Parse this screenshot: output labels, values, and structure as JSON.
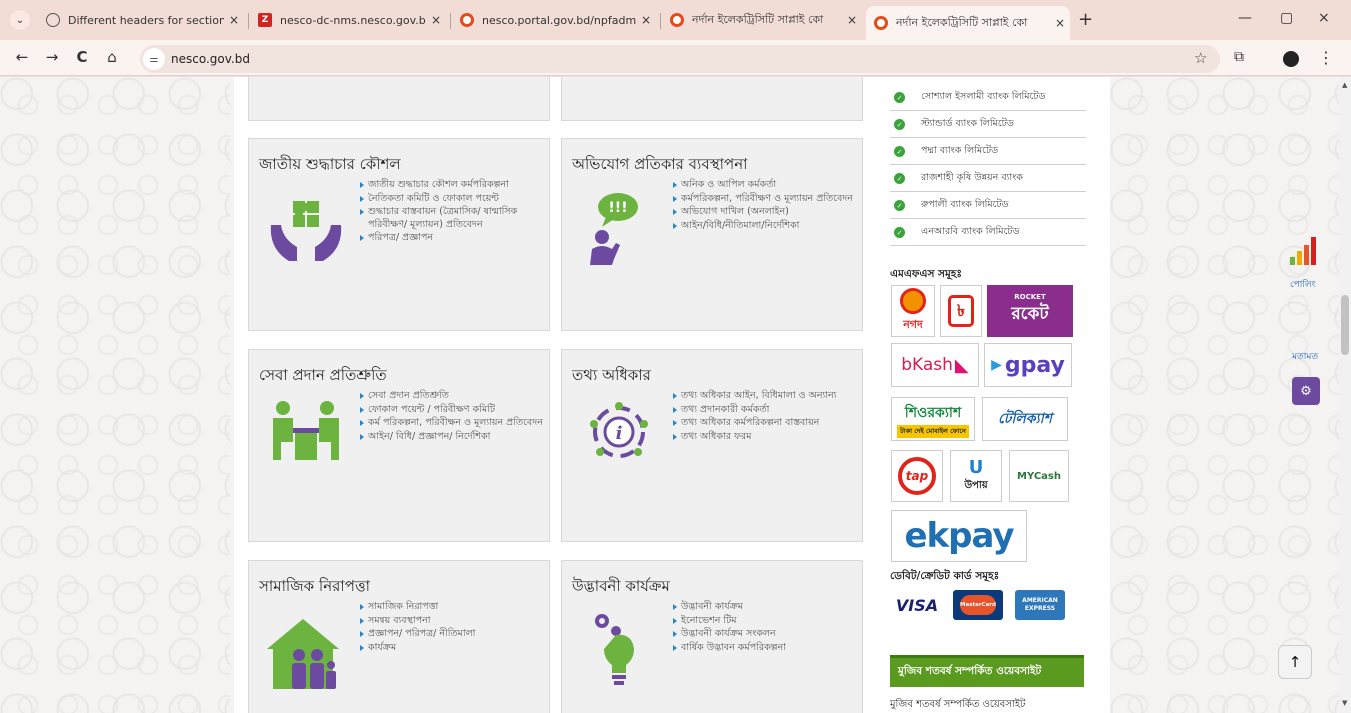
{
  "browser": {
    "tabs": [
      {
        "label": "Different headers for sections",
        "icon": "globe-icon",
        "active": false
      },
      {
        "label": "nesco-dc-nms.nesco.gov.bd:8",
        "icon": "z-favicon-icon",
        "active": false
      },
      {
        "label": "nesco.portal.gov.bd/npfadmin",
        "icon": "nesco-favicon-icon",
        "active": false
      },
      {
        "label": "নর্দান ইলেকট্রিসিটি সাপ্লাই কো",
        "icon": "nesco-favicon-icon",
        "active": false
      },
      {
        "label": "নর্দান ইলেকট্রিসিটি সাপ্লাই কো",
        "icon": "nesco-favicon-icon",
        "active": true
      }
    ],
    "url": "nesco.gov.bd",
    "tab_dropdown": "⌄",
    "new_tab": "+",
    "back": "←",
    "forward": "→",
    "reload": "C",
    "home": "⌂",
    "bookmark": "☆",
    "extensions": "⧉",
    "menu": "⋮",
    "close_tab": "×",
    "minimize": "—",
    "maximize": "▢",
    "close_window": "×"
  },
  "cards": [
    {
      "title": "জাতীয় শুদ্ধাচার কৌশল",
      "icon": "integrity-hands-icon",
      "links": [
        "জাতীয় শুদ্ধাচার কৌশল কর্মপরিকল্পনা",
        "নৈতিকতা কমিটি ও ফোকাল পয়েন্ট",
        "শুদ্ধাচার বাস্তবায়ন (ত্রৈমাসিক/ ষান্মাসিক পরিবীক্ষণ/ মূল্যায়ন) প্রতিবেদন",
        "পরিপত্র/ প্রজ্ঞাপন"
      ]
    },
    {
      "title": "অভিযোগ প্রতিকার ব্যবস্থাপনা",
      "icon": "complaint-speech-icon",
      "links": [
        "অনিক ও আপিল কর্মকর্তা",
        "কর্মপরিকল্পনা, পরিবীক্ষণ ও মূল্যায়ন প্রতিবেদন",
        "অভিযোগ দাখিল (অনলাইন)",
        "আইন/বিধি/নীতিমালা/নির্দেশিকা"
      ]
    },
    {
      "title": "সেবা প্রদান প্রতিশ্রুতি",
      "icon": "service-meeting-icon",
      "links": [
        "সেবা প্রদান প্রতিশ্রুতি",
        "ফোকাল পয়েন্ট / পরিবীক্ষণ কমিটি",
        "কর্ম পরিকল্পনা, পরিবীক্ষন ও মূল্যায়ন প্রতিবেদন",
        "আইন/ বিধি/ প্রজ্ঞাপন/ নির্দেশিকা"
      ]
    },
    {
      "title": "তথ্য অধিকার",
      "icon": "information-icon",
      "links": [
        "তথ্য অধিকার আইন, বিধিমালা ও অন্যান্য",
        "তথ্য প্রদানকারী কর্মকর্তা",
        "তথ্য অধিকার কর্মপরিকল্পনা বাস্তবায়ন",
        "তথ্য অধিকার ফরম"
      ]
    },
    {
      "title": "সামাজিক নিরাপত্তা",
      "icon": "family-house-icon",
      "links": [
        "সামাজিক নিরাপত্তা",
        "সমন্বয় ব্যবস্থাপনা",
        "প্রজ্ঞাপন/ পরিপত্র/ নীতিমালা",
        "কার্যক্রম"
      ]
    },
    {
      "title": "উদ্ভাবনী কার্যক্রম",
      "icon": "innovation-bulb-icon",
      "links": [
        "উদ্ভাবনী কার্যক্রম",
        "ইনোভেশন টিম",
        "উদ্ভাবনী কার্যক্রম সংকলন",
        "বার্ষিক উদ্ভাবন কর্মপরিকল্পনা"
      ]
    }
  ],
  "sidebar": {
    "banks": [
      "সোশ্যাল ইসলামী ব্যাংক লিমিটেড",
      "স্ট্যান্ডার্ড ব্যাংক লিমিটেড",
      "পদ্মা ব্যাংক লিমিটেড",
      "রাজশাহী কৃষি উন্নয়ন ব্যাংক",
      "রুপালী ব্যাংক লিমিটেড",
      "এনআরবি ব্যাংক লিমিটেড"
    ],
    "mfs_heading": "এমএফএস সমূহঃ",
    "mfs_logos": {
      "nagad": "নগদ",
      "rocket_small": "ROCKET",
      "rocket": "রকেট",
      "bkash": "bKash",
      "gpay": "gpay",
      "shurecash": "শিওরক্যাশ",
      "shurecash_sub": "টাকা দেই মোবাইল ফোনে",
      "telecash": "টেলিক্যাশ",
      "tap": "tap",
      "upay": "উপায়",
      "mycash": "MYCash",
      "ekpay": "ekpay"
    },
    "card_heading": "ডেবিট/ক্রেডিট কার্ড সমূহঃ",
    "card_logos": {
      "visa": "VISA",
      "mastercard": "MasterCard",
      "amex": "AMERICAN EXPRESS"
    },
    "mujib_banner": "মুজিব শতবর্ষ সম্পর্কিত ওয়েবসাইট",
    "mujib_link": "মুজিব শতবর্ষ সম্পর্কিত ওয়েবসাইট"
  },
  "floating": {
    "poll_label": "পোলিং",
    "opinion_label": "মতামত",
    "accessibility_icon": "⚙",
    "back_to_top": "↑"
  },
  "colors": {
    "accent_green": "#5a9a1e",
    "link_bullet": "#2b83c5",
    "icon_purple": "#6b4aa0",
    "icon_green": "#6cb33f"
  }
}
